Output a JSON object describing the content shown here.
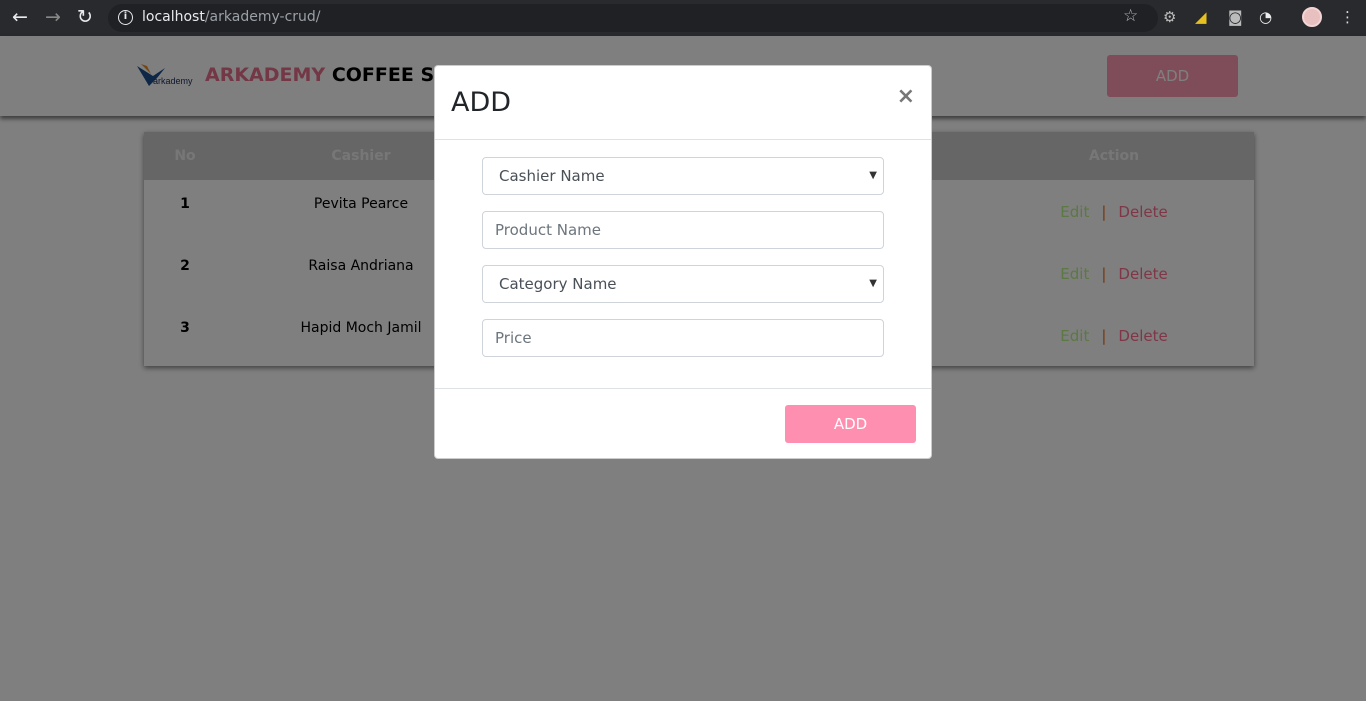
{
  "browser": {
    "url_host": "localhost",
    "url_path": "/arkademy-crud/",
    "icons": [
      "back-icon",
      "forward-icon",
      "reload-icon",
      "info-icon",
      "star-icon",
      "extension-icon",
      "profile-avatar",
      "menu-icon"
    ]
  },
  "header": {
    "brand_pink": "ARKADEMY",
    "brand_dark": "COFFEE SHOP",
    "logo_text": "arkademy",
    "add_label": "ADD"
  },
  "table": {
    "headers": {
      "no": "No",
      "cashier": "Cashier",
      "action": "Action"
    },
    "rows": [
      {
        "no": "1",
        "cashier": "Pevita Pearce"
      },
      {
        "no": "2",
        "cashier": "Raisa Andriana"
      },
      {
        "no": "3",
        "cashier": "Hapid Moch Jamil"
      }
    ],
    "edit_label": "Edit",
    "separator": "|",
    "delete_label": "Delete"
  },
  "modal": {
    "title": "ADD",
    "close": "×",
    "cashier_select": "Cashier Name",
    "product_placeholder": "Product Name",
    "category_select": "Category Name",
    "price_placeholder": "Price",
    "submit_label": "ADD"
  },
  "colors": {
    "accent_pink": "#ff8fb1",
    "edit": "#b8f088",
    "delete": "#ff6e8e"
  }
}
